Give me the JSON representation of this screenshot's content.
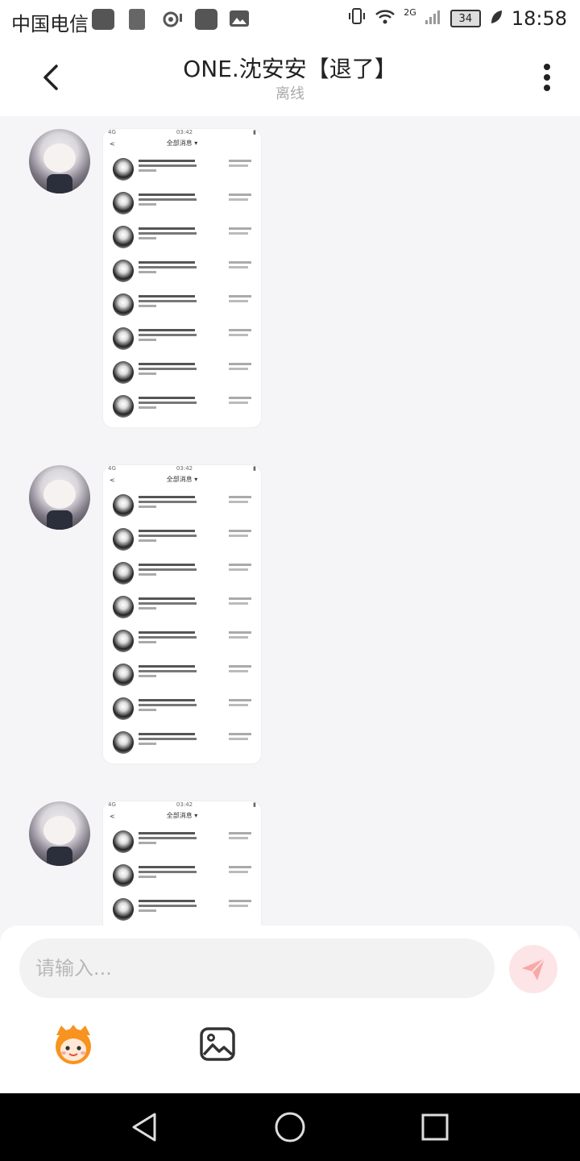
{
  "status_bar": {
    "carrier": "中国电信",
    "network": "2G",
    "battery": "34",
    "time": "18:58"
  },
  "header": {
    "title": "ONE.沈安安【退了】",
    "subtitle": "离线"
  },
  "messages": [
    {
      "type": "image",
      "time": "03:42",
      "header": "全部消息"
    },
    {
      "type": "image",
      "time": "03:42",
      "header": "全部消息"
    },
    {
      "type": "image",
      "time": "03:42",
      "header": "全部消息"
    }
  ],
  "composer": {
    "placeholder": "请输入..."
  },
  "colors": {
    "send_button_bg": "#fde4e6",
    "send_icon": "#f7a9a8"
  },
  "icons": {
    "emoji": "emoji-face-icon",
    "image": "image-icon",
    "send": "send-icon",
    "back": "chevron-left-icon",
    "more": "more-vertical-icon"
  }
}
